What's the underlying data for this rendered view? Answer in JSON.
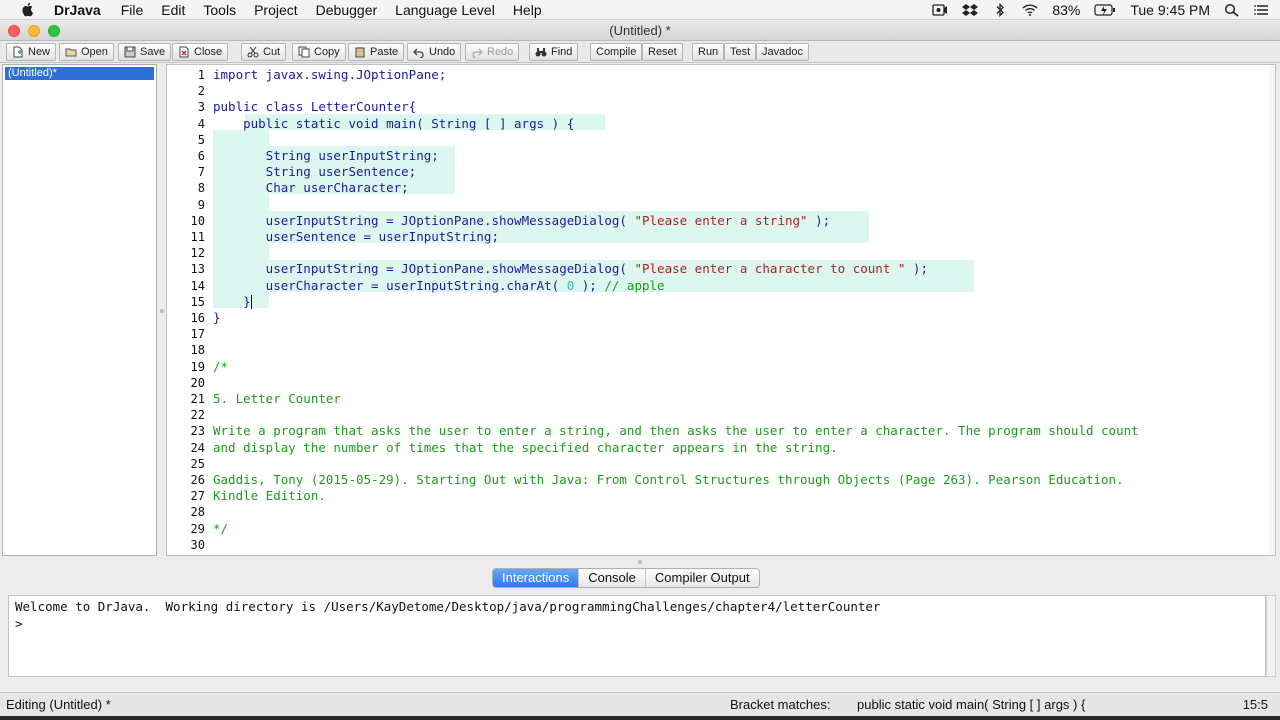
{
  "menubar": {
    "app_name": "DrJava",
    "menus": [
      "File",
      "Edit",
      "Tools",
      "Project",
      "Debugger",
      "Language Level",
      "Help"
    ],
    "battery": "83%",
    "clock": "Tue 9:45 PM"
  },
  "window": {
    "title": "(Untitled) *"
  },
  "toolbar": {
    "new": "New",
    "open": "Open",
    "save": "Save",
    "close": "Close",
    "cut": "Cut",
    "copy": "Copy",
    "paste": "Paste",
    "undo": "Undo",
    "redo": "Redo",
    "find": "Find",
    "compile": "Compile",
    "reset": "Reset",
    "run": "Run",
    "test": "Test",
    "javadoc": "Javadoc"
  },
  "documents": [
    {
      "name": "(Untitled)*"
    }
  ],
  "editor": {
    "line_numbers": [
      "1",
      "2",
      "3",
      "4",
      "5",
      "6",
      "7",
      "8",
      "9",
      "10",
      "11",
      "12",
      "13",
      "14",
      "15",
      "16",
      "17",
      "18",
      "19",
      "20",
      "21",
      "22",
      "23",
      "24",
      "25",
      "26",
      "27",
      "28",
      "29",
      "30"
    ],
    "lines": [
      {
        "ln": "1",
        "t": "import javax.swing.JOptionPane;"
      },
      {
        "ln": "3",
        "t": "public class LetterCounter{"
      },
      {
        "ln": "4",
        "t": "    public static void main( String [ ] args ) {"
      },
      {
        "ln": "6",
        "t": "       String userInputString;"
      },
      {
        "ln": "7",
        "t": "       String userSentence;"
      },
      {
        "ln": "8",
        "t": "       Char userCharacter;"
      },
      {
        "ln": "10a",
        "t": "       userInputString = "
      },
      {
        "ln": "10b",
        "t": "JOptionPane"
      },
      {
        "ln": "10c",
        "t": ".showMessageDialog( "
      },
      {
        "ln": "10d",
        "t": "\"Please enter a string\""
      },
      {
        "ln": "10e",
        "t": " );"
      },
      {
        "ln": "11",
        "t": "       userSentence = userInputString;"
      },
      {
        "ln": "13a",
        "t": "       userInputString = "
      },
      {
        "ln": "13b",
        "t": "JOptionPane"
      },
      {
        "ln": "13c",
        "t": ".showMessageDialog( "
      },
      {
        "ln": "13d",
        "t": "\"Please enter a character to count \""
      },
      {
        "ln": "13e",
        "t": " );"
      },
      {
        "ln": "14a",
        "t": "       userCharacter = userInputString.charAt( "
      },
      {
        "ln": "14b",
        "t": "0"
      },
      {
        "ln": "14c",
        "t": " ); "
      },
      {
        "ln": "14d",
        "t": "// apple"
      },
      {
        "ln": "15",
        "t": "    }"
      },
      {
        "ln": "16",
        "t": "}"
      },
      {
        "ln": "19",
        "t": "/*"
      },
      {
        "ln": "21",
        "t": "5. Letter Counter"
      },
      {
        "ln": "23",
        "t": "Write a program that asks the user to enter a string, and then asks the user to enter a character. The program should count"
      },
      {
        "ln": "24",
        "t": "and display the number of times that the specified character appears in the string."
      },
      {
        "ln": "26",
        "t": "Gaddis, Tony (2015-05-29). Starting Out with Java: From Control Structures through Objects (Page 263). Pearson Education."
      },
      {
        "ln": "27",
        "t": "Kindle Edition."
      },
      {
        "ln": "29",
        "t": "*/"
      }
    ]
  },
  "panel": {
    "tabs": [
      "Interactions",
      "Console",
      "Compiler Output"
    ],
    "active_tab": "Interactions",
    "console_lines": [
      "Welcome to DrJava.  Working directory is /Users/KayDetome/Desktop/java/programmingChallenges/chapter4/letterCounter",
      ">"
    ]
  },
  "status": {
    "editing": "Editing (Untitled) *",
    "bracket_label": "Bracket matches:",
    "bracket_value": "public static void main( String [ ] args ) {",
    "position": "15:5"
  }
}
